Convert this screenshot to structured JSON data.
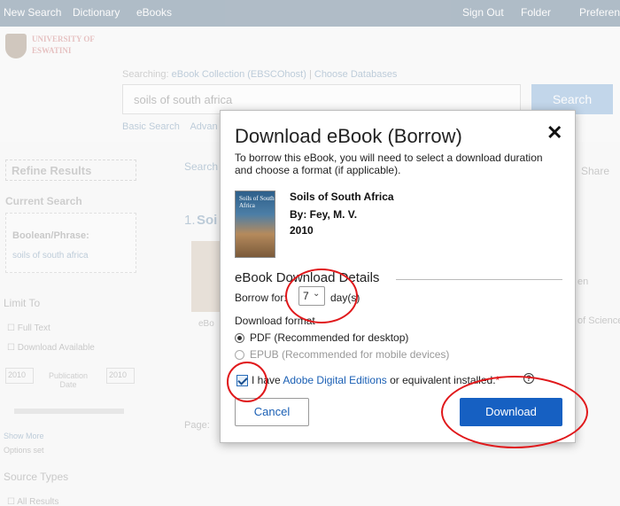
{
  "topbar": {
    "new_search": "New Search",
    "dictionary": "Dictionary",
    "ebooks": "eBooks",
    "sign_out": "Sign Out",
    "folder": "Folder",
    "preferences": "Preferen"
  },
  "brand": {
    "line1": "UNIVERSITY OF",
    "line2": "ESWATINI"
  },
  "search": {
    "searching_prefix": "Searching:",
    "collection": "eBook Collection (EBSCOhost)",
    "choose_db": "Choose Databases",
    "query": "soils of south africa",
    "button": "Search",
    "basic": "Basic Search",
    "advanced": "Advan"
  },
  "sidebar": {
    "refine": "Refine Results",
    "current_search": "Current Search",
    "boolean": "Boolean/Phrase:",
    "query": "soils of south africa",
    "limit_to": "Limit To",
    "full_text": "Full Text",
    "download_available": "Download Available",
    "year_from": "2010",
    "year_to": "2010",
    "publication_date": "Publication Date",
    "show_more": "Show More",
    "options_set": "Options set",
    "source_types": "Source Types",
    "all_results": "All Results"
  },
  "background": {
    "search_label": "Search",
    "share": "Share",
    "result_num": "1.",
    "result_title": "Soi",
    "ebook_label": "eBo",
    "page_label": "Page:",
    "side_text1": "en",
    "side_text2": "of Science,"
  },
  "modal": {
    "title": "Download eBook (Borrow)",
    "close": "✕",
    "description": "To borrow this eBook, you will need to select a download duration and choose a format (if applicable).",
    "cover_text": "Soils of South Africa",
    "book": {
      "title": "Soils of South Africa",
      "author": "By: Fey, M. V.",
      "year": "2010"
    },
    "section_heading": "eBook Download Details",
    "borrow_label": "Borrow for:",
    "borrow_value": "7",
    "borrow_suffix": "day(s)",
    "format_label": "Download format",
    "formats": [
      {
        "label": "PDF (Recommended for desktop)",
        "selected": true
      },
      {
        "label": "EPUB (Recommended for mobile devices)",
        "selected": false
      }
    ],
    "agree_prefix": "I have",
    "agree_link": "Adobe Digital Editions",
    "agree_suffix": "or equivalent installed.",
    "required_mark": "*",
    "help": "?",
    "cancel": "Cancel",
    "download": "Download"
  },
  "icons": {
    "close": "close-icon",
    "chevron": "chevron-down-icon",
    "help": "help-icon",
    "checkbox": "checkbox-checked-icon"
  },
  "colors": {
    "primary_button": "#1660c2",
    "link": "#1a5fb4",
    "annotation": "#e0181b",
    "required": "#cc0000"
  }
}
